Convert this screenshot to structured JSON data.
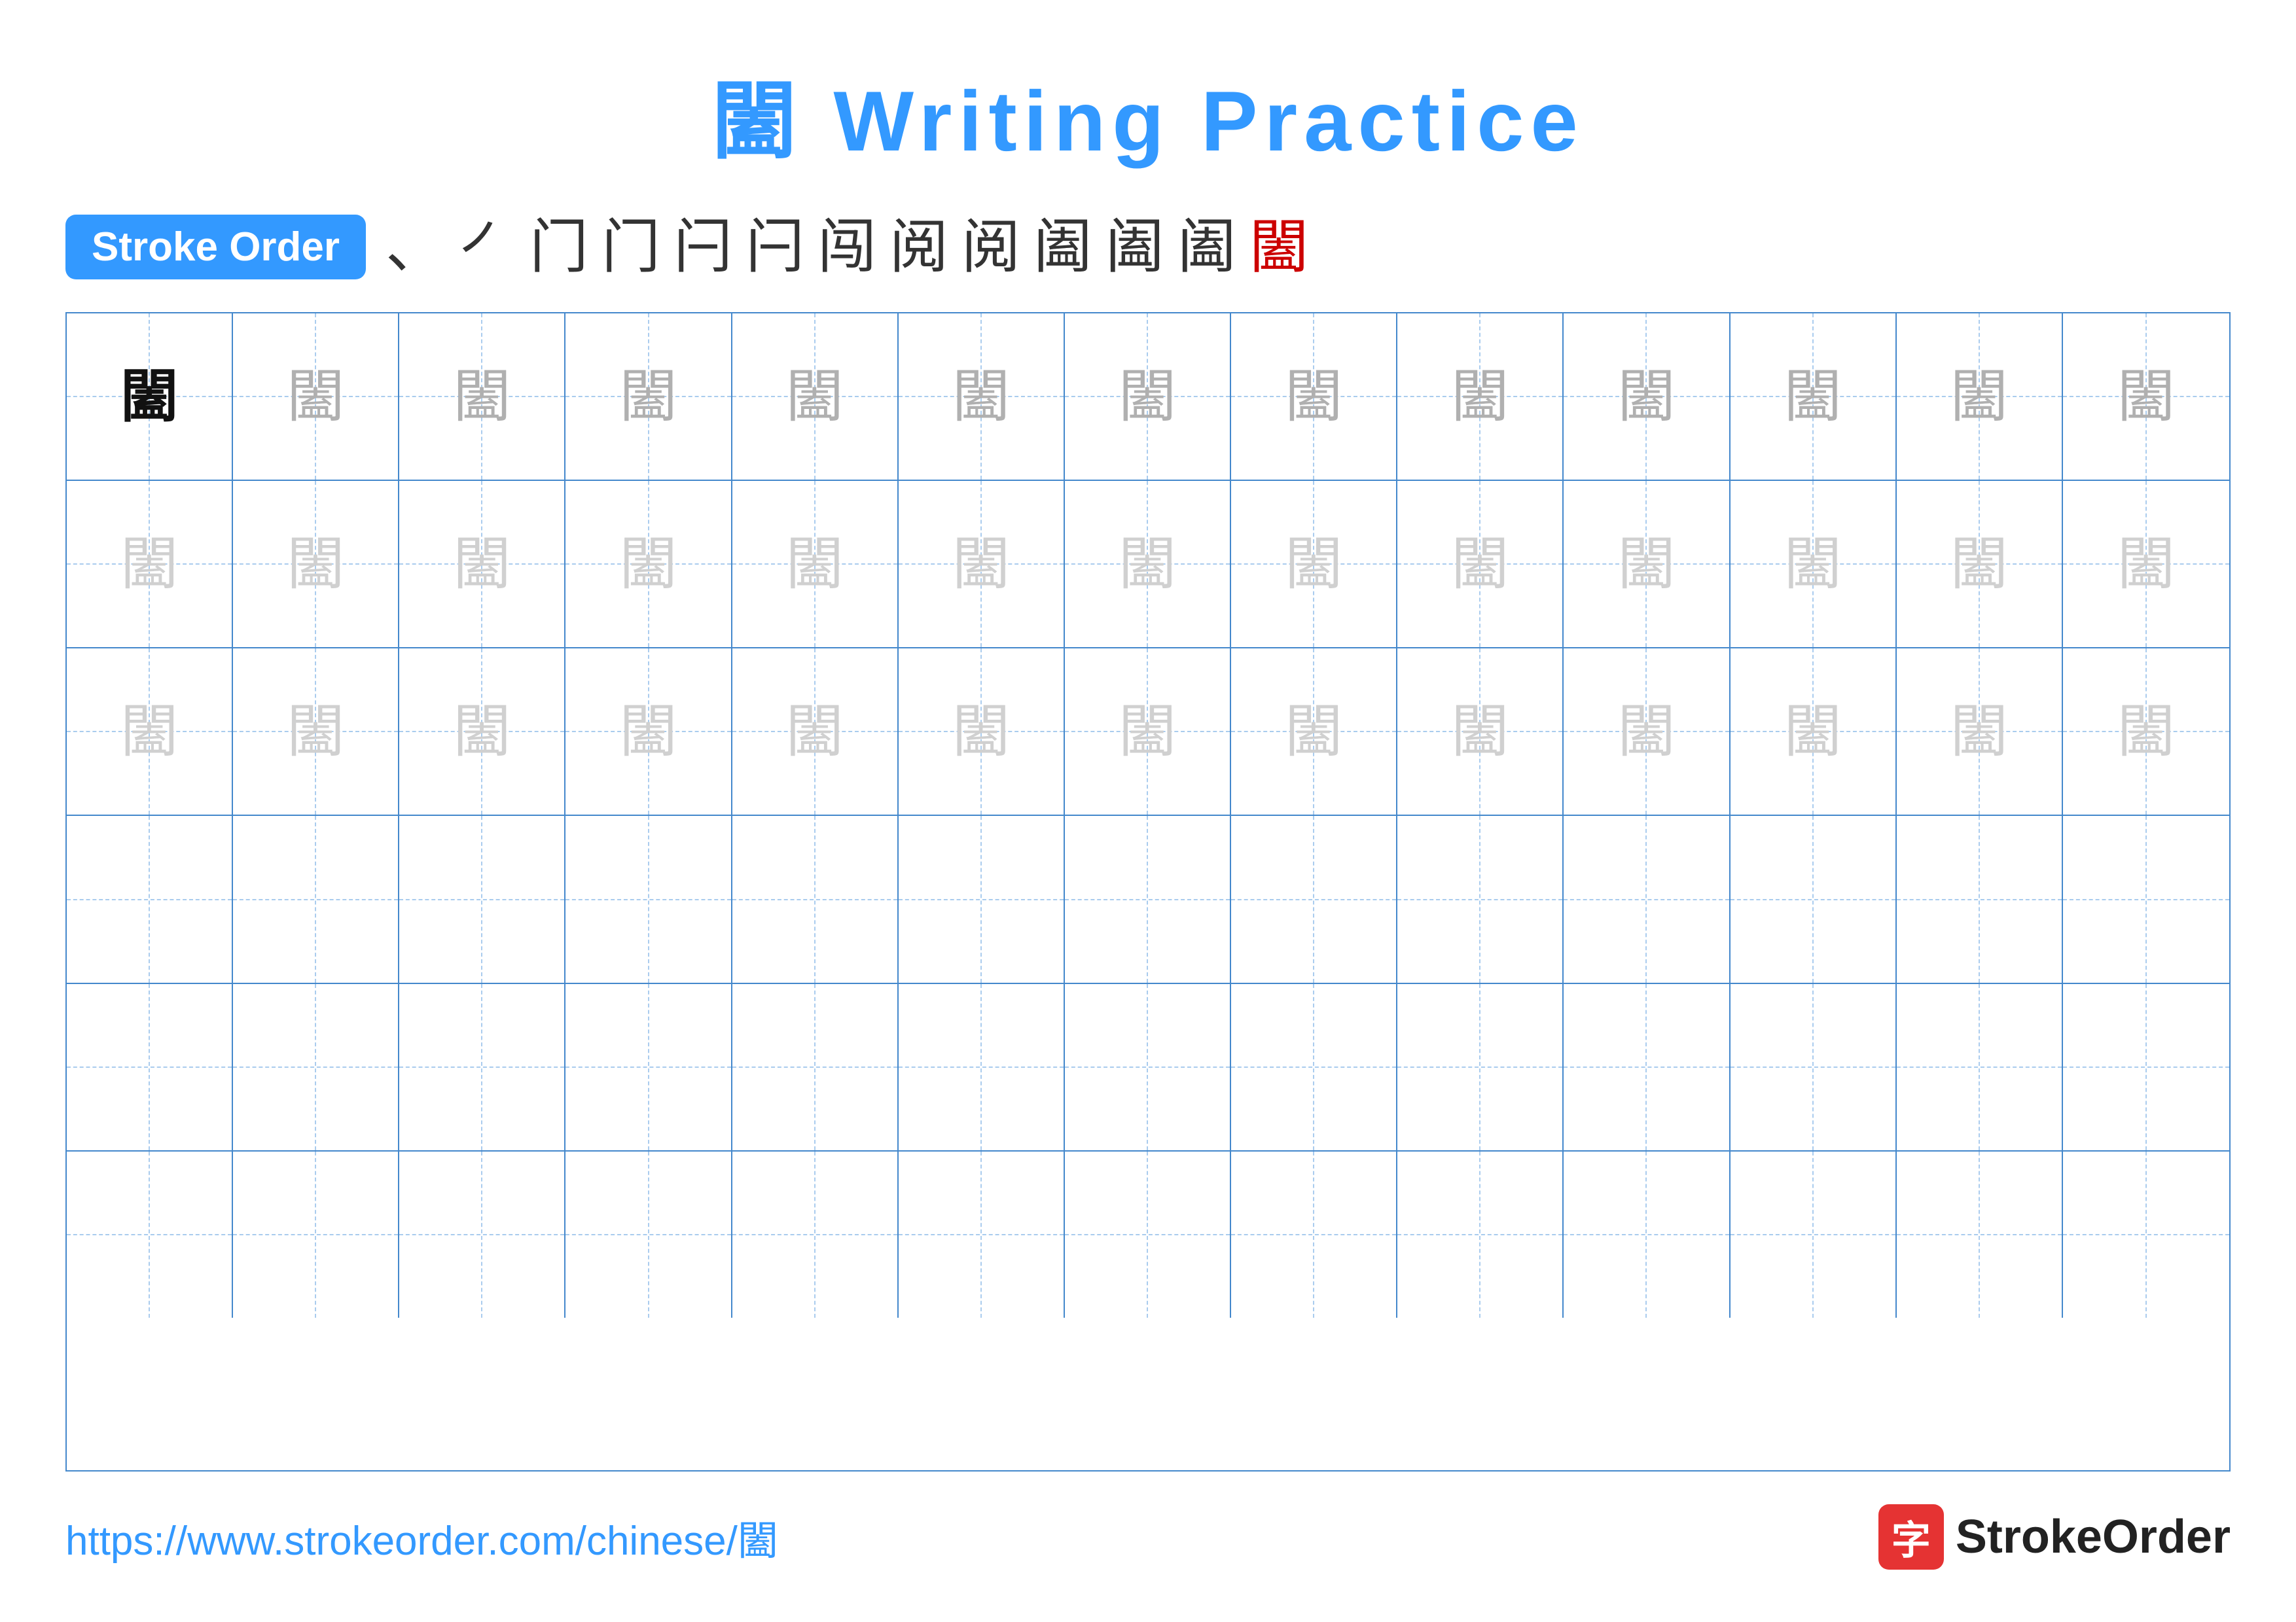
{
  "title": {
    "char": "闔",
    "suffix": " Writing Practice"
  },
  "stroke_order": {
    "badge_label": "Stroke Order",
    "strokes": [
      "、",
      "㇒",
      "门",
      "门",
      "闩",
      "闩",
      "闯",
      "阅",
      "阅",
      "阖",
      "阖",
      "阖",
      "闔"
    ]
  },
  "grid": {
    "rows": [
      {
        "cells": [
          {
            "char": "闔",
            "style": "dark"
          },
          {
            "char": "闔",
            "style": "medium"
          },
          {
            "char": "闔",
            "style": "medium"
          },
          {
            "char": "闔",
            "style": "medium"
          },
          {
            "char": "闔",
            "style": "medium"
          },
          {
            "char": "闔",
            "style": "medium"
          },
          {
            "char": "闔",
            "style": "medium"
          },
          {
            "char": "闔",
            "style": "medium"
          },
          {
            "char": "闔",
            "style": "medium"
          },
          {
            "char": "闔",
            "style": "medium"
          },
          {
            "char": "闔",
            "style": "medium"
          },
          {
            "char": "闔",
            "style": "medium"
          },
          {
            "char": "闔",
            "style": "medium"
          }
        ]
      },
      {
        "cells": [
          {
            "char": "闔",
            "style": "light"
          },
          {
            "char": "闔",
            "style": "light"
          },
          {
            "char": "闔",
            "style": "light"
          },
          {
            "char": "闔",
            "style": "light"
          },
          {
            "char": "闔",
            "style": "light"
          },
          {
            "char": "闔",
            "style": "light"
          },
          {
            "char": "闔",
            "style": "light"
          },
          {
            "char": "闔",
            "style": "light"
          },
          {
            "char": "闔",
            "style": "light"
          },
          {
            "char": "闔",
            "style": "light"
          },
          {
            "char": "闔",
            "style": "light"
          },
          {
            "char": "闔",
            "style": "light"
          },
          {
            "char": "闔",
            "style": "light"
          }
        ]
      },
      {
        "cells": [
          {
            "char": "闔",
            "style": "light"
          },
          {
            "char": "闔",
            "style": "light"
          },
          {
            "char": "闔",
            "style": "light"
          },
          {
            "char": "闔",
            "style": "light"
          },
          {
            "char": "闔",
            "style": "light"
          },
          {
            "char": "闔",
            "style": "light"
          },
          {
            "char": "闔",
            "style": "light"
          },
          {
            "char": "闔",
            "style": "light"
          },
          {
            "char": "闔",
            "style": "light"
          },
          {
            "char": "闔",
            "style": "light"
          },
          {
            "char": "闔",
            "style": "light"
          },
          {
            "char": "闔",
            "style": "light"
          },
          {
            "char": "闔",
            "style": "light"
          }
        ]
      },
      {
        "cells": [
          {
            "char": "",
            "style": "empty"
          },
          {
            "char": "",
            "style": "empty"
          },
          {
            "char": "",
            "style": "empty"
          },
          {
            "char": "",
            "style": "empty"
          },
          {
            "char": "",
            "style": "empty"
          },
          {
            "char": "",
            "style": "empty"
          },
          {
            "char": "",
            "style": "empty"
          },
          {
            "char": "",
            "style": "empty"
          },
          {
            "char": "",
            "style": "empty"
          },
          {
            "char": "",
            "style": "empty"
          },
          {
            "char": "",
            "style": "empty"
          },
          {
            "char": "",
            "style": "empty"
          },
          {
            "char": "",
            "style": "empty"
          }
        ]
      },
      {
        "cells": [
          {
            "char": "",
            "style": "empty"
          },
          {
            "char": "",
            "style": "empty"
          },
          {
            "char": "",
            "style": "empty"
          },
          {
            "char": "",
            "style": "empty"
          },
          {
            "char": "",
            "style": "empty"
          },
          {
            "char": "",
            "style": "empty"
          },
          {
            "char": "",
            "style": "empty"
          },
          {
            "char": "",
            "style": "empty"
          },
          {
            "char": "",
            "style": "empty"
          },
          {
            "char": "",
            "style": "empty"
          },
          {
            "char": "",
            "style": "empty"
          },
          {
            "char": "",
            "style": "empty"
          },
          {
            "char": "",
            "style": "empty"
          }
        ]
      },
      {
        "cells": [
          {
            "char": "",
            "style": "empty"
          },
          {
            "char": "",
            "style": "empty"
          },
          {
            "char": "",
            "style": "empty"
          },
          {
            "char": "",
            "style": "empty"
          },
          {
            "char": "",
            "style": "empty"
          },
          {
            "char": "",
            "style": "empty"
          },
          {
            "char": "",
            "style": "empty"
          },
          {
            "char": "",
            "style": "empty"
          },
          {
            "char": "",
            "style": "empty"
          },
          {
            "char": "",
            "style": "empty"
          },
          {
            "char": "",
            "style": "empty"
          },
          {
            "char": "",
            "style": "empty"
          },
          {
            "char": "",
            "style": "empty"
          }
        ]
      }
    ]
  },
  "footer": {
    "url": "https://www.strokeorder.com/chinese/闔",
    "logo_text": "StrokeOrder",
    "logo_char": "字"
  }
}
